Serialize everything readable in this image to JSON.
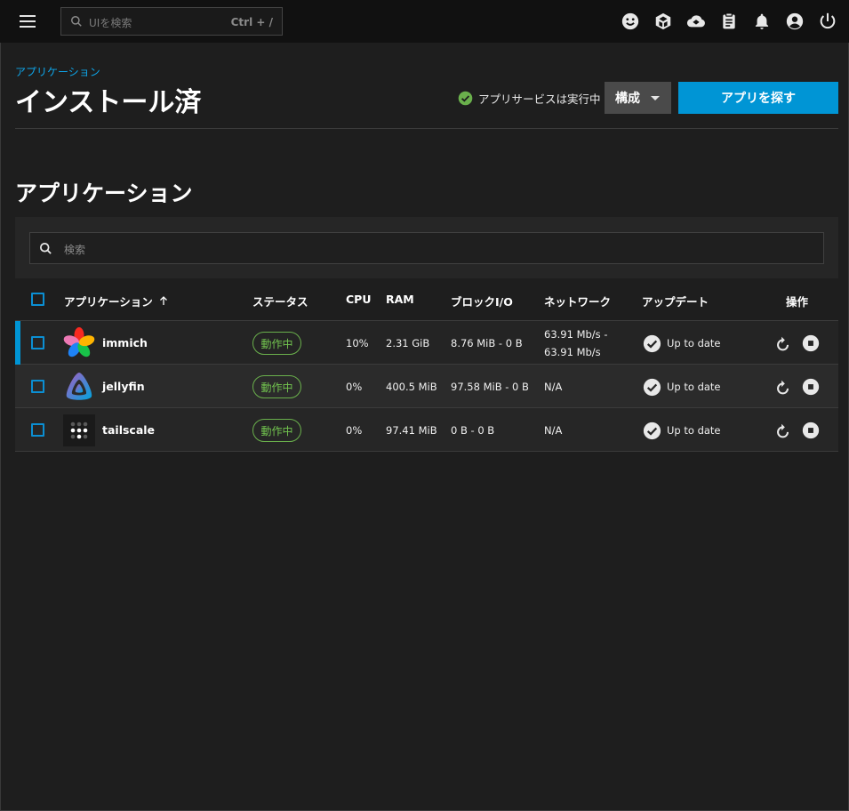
{
  "topbar": {
    "search_placeholder": "UIを検索",
    "search_shortcut": "Ctrl + /",
    "icons": [
      "menu-icon",
      "search-icon",
      "smiley-icon",
      "cube-icon",
      "cloud-sync-icon",
      "clipboard-icon",
      "bell-icon",
      "account-circle-icon",
      "power-icon"
    ]
  },
  "header": {
    "breadcrumb": "アプリケーション",
    "title": "インストール済",
    "service_status": "アプリサービスは実行中",
    "config_label": "構成",
    "discover_label": "アプリを探す"
  },
  "section": {
    "title": "アプリケーション",
    "search_placeholder": "検索"
  },
  "table": {
    "columns": {
      "app": "アプリケーション",
      "status": "ステータス",
      "cpu": "CPU",
      "ram": "RAM",
      "block_io": "ブロックI/O",
      "network": "ネットワーク",
      "update": "アップデート",
      "actions": "操作"
    },
    "sort_icon": "arrow-up-icon",
    "rows": [
      {
        "name": "immich",
        "status": "動作中",
        "cpu": "10%",
        "ram": "2.31 GiB",
        "block_io": "8.76 MiB - 0 B",
        "network_line1": "63.91 Mb/s -",
        "network_line2": "63.91 Mb/s",
        "update": "Up to date",
        "icon": "immich-logo"
      },
      {
        "name": "jellyfin",
        "status": "動作中",
        "cpu": "0%",
        "ram": "400.5 MiB",
        "block_io": "97.58 MiB - 0 B",
        "network_line1": "N/A",
        "update": "Up to date",
        "icon": "jellyfin-logo"
      },
      {
        "name": "tailscale",
        "status": "動作中",
        "cpu": "0%",
        "ram": "97.41 MiB",
        "block_io": "0 B - 0 B",
        "network_line1": "N/A",
        "update": "Up to date",
        "icon": "tailscale-logo"
      }
    ]
  },
  "colors": {
    "accent": "#0095d5",
    "running": "#72c44f",
    "background": "#1e1e1e",
    "topbar": "#111111"
  }
}
